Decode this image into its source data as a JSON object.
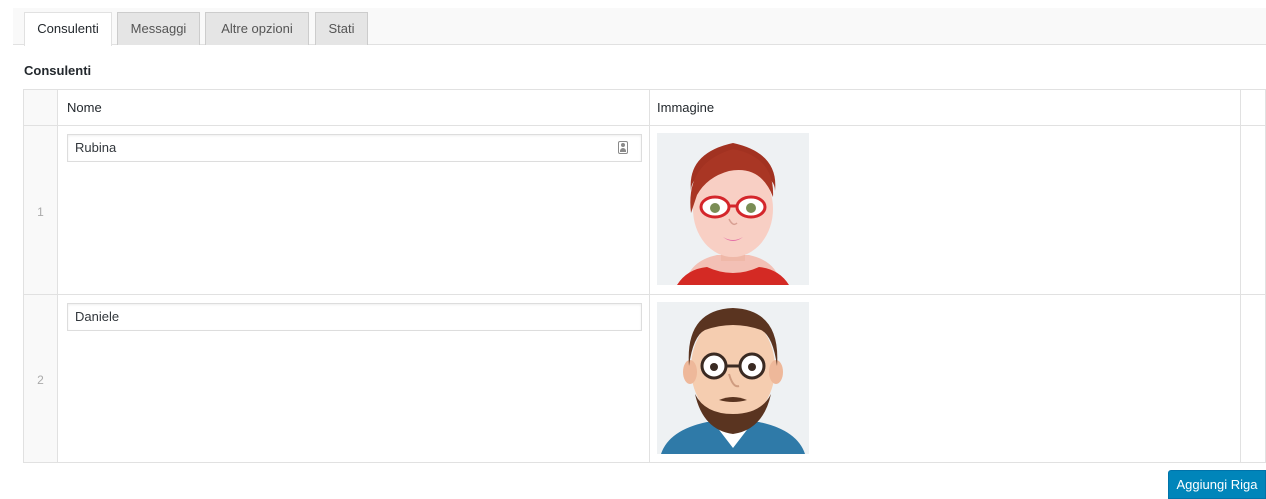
{
  "tabs": [
    {
      "label": "Consulenti",
      "active": true
    },
    {
      "label": "Messaggi",
      "active": false
    },
    {
      "label": "Altre opzioni",
      "active": false
    },
    {
      "label": "Stati",
      "active": false
    }
  ],
  "section_title": "Consulenti",
  "table": {
    "headers": {
      "name": "Nome",
      "image": "Immagine"
    },
    "rows": [
      {
        "index": "1",
        "name": "Rubina",
        "image_icon": "female-avatar-icon"
      },
      {
        "index": "2",
        "name": "Daniele",
        "image_icon": "male-avatar-icon"
      }
    ]
  },
  "add_row_label": "Aggiungi Riga",
  "colors": {
    "accent": "#0085ba",
    "border": "#e1e1e1",
    "tab_bg": "#e5e5e5"
  }
}
